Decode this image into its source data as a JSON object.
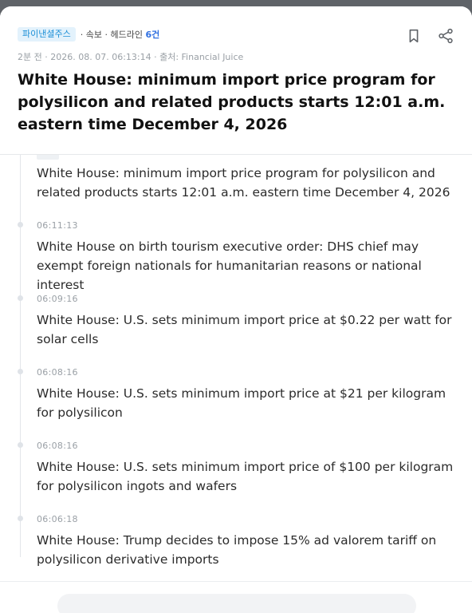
{
  "header": {
    "badge": "파이낸셜주스",
    "category_prefix": "· 속보 · 헤드라인 ",
    "count": "6건",
    "meta": "2분 전 · 2026. 08. 07. 06:13:14 · 출처: Financial Juice",
    "title": "White House: minimum import price program for polysilicon and related products starts 12:01 a.m. eastern time December 4, 2026"
  },
  "icons": {
    "bookmark": "bookmark-icon",
    "share": "share-icon"
  },
  "timeline": {
    "items": [
      {
        "time": "",
        "text": "White House: minimum import price program for polysilicon and related products starts 12:01 a.m. eastern time December 4, 2026"
      },
      {
        "time": "06:11:13",
        "text": "White House on birth tourism executive order: DHS chief may exempt foreign nationals for humanitarian reasons or national interest"
      },
      {
        "time": "06:09:16",
        "text": "White House: U.S. sets minimum import price at $0.22 per watt for solar cells"
      },
      {
        "time": "06:08:16",
        "text": "White House: U.S. sets minimum import price at $21 per kilogram for polysilicon"
      },
      {
        "time": "06:08:16",
        "text": "White House: U.S. sets minimum import price of $100 per kilogram for polysilicon ingots and wafers"
      },
      {
        "time": "06:06:18",
        "text": "White House: Trump decides to impose 15% ad valorem tariff on polysilicon derivative imports"
      }
    ]
  }
}
